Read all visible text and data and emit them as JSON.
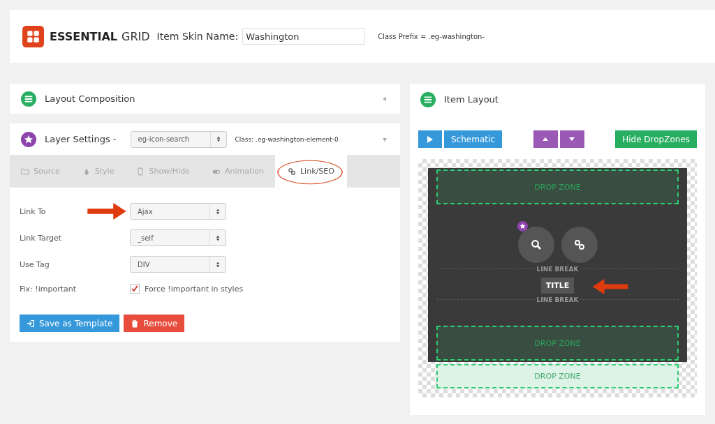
{
  "header": {
    "logo_bold": "ESSENTIAL",
    "logo_light": "GRID",
    "skin_label": "Item Skin Name:",
    "skin_value": "Washington",
    "class_prefix": "Class Prefix = .eg-washington-"
  },
  "layout_composition": {
    "title": "Layout Composition",
    "expanded": false
  },
  "layer_settings": {
    "title": "Layer Settings -",
    "element": "eg-icon-search",
    "class_text": "Class: .eg-washington-element-0",
    "tabs": [
      {
        "label": "Source",
        "selected": false
      },
      {
        "label": "Style",
        "selected": false
      },
      {
        "label": "Show/Hide",
        "selected": false
      },
      {
        "label": "Animation",
        "selected": false
      },
      {
        "label": "Link/SEO",
        "selected": true
      }
    ],
    "fields": [
      {
        "kind": "select",
        "label": "Link To",
        "value": "Ajax",
        "pointer": true
      },
      {
        "kind": "select",
        "label": "Link Target",
        "value": "_self",
        "pointer": false
      },
      {
        "kind": "select",
        "label": "Use Tag",
        "value": "DIV",
        "pointer": false
      },
      {
        "kind": "checkbox",
        "label": "Fix: !important",
        "value": "Force !important in styles",
        "checked": true
      }
    ],
    "buttons": [
      {
        "label": "Save as Template",
        "kind": "save"
      },
      {
        "label": "Remove",
        "kind": "remove"
      }
    ]
  },
  "item_layout": {
    "title": "Item Layout",
    "buttons": [
      {
        "label": "Schematic"
      },
      {
        "label": "Hide DropZones"
      }
    ],
    "drop_zone_labels": [
      "DROP ZONE",
      "DROP ZONE",
      "DROP ZONE"
    ],
    "line_breaks": [
      "LINE BREAK",
      "LINE BREAK"
    ],
    "title_layer": "TITLE"
  }
}
